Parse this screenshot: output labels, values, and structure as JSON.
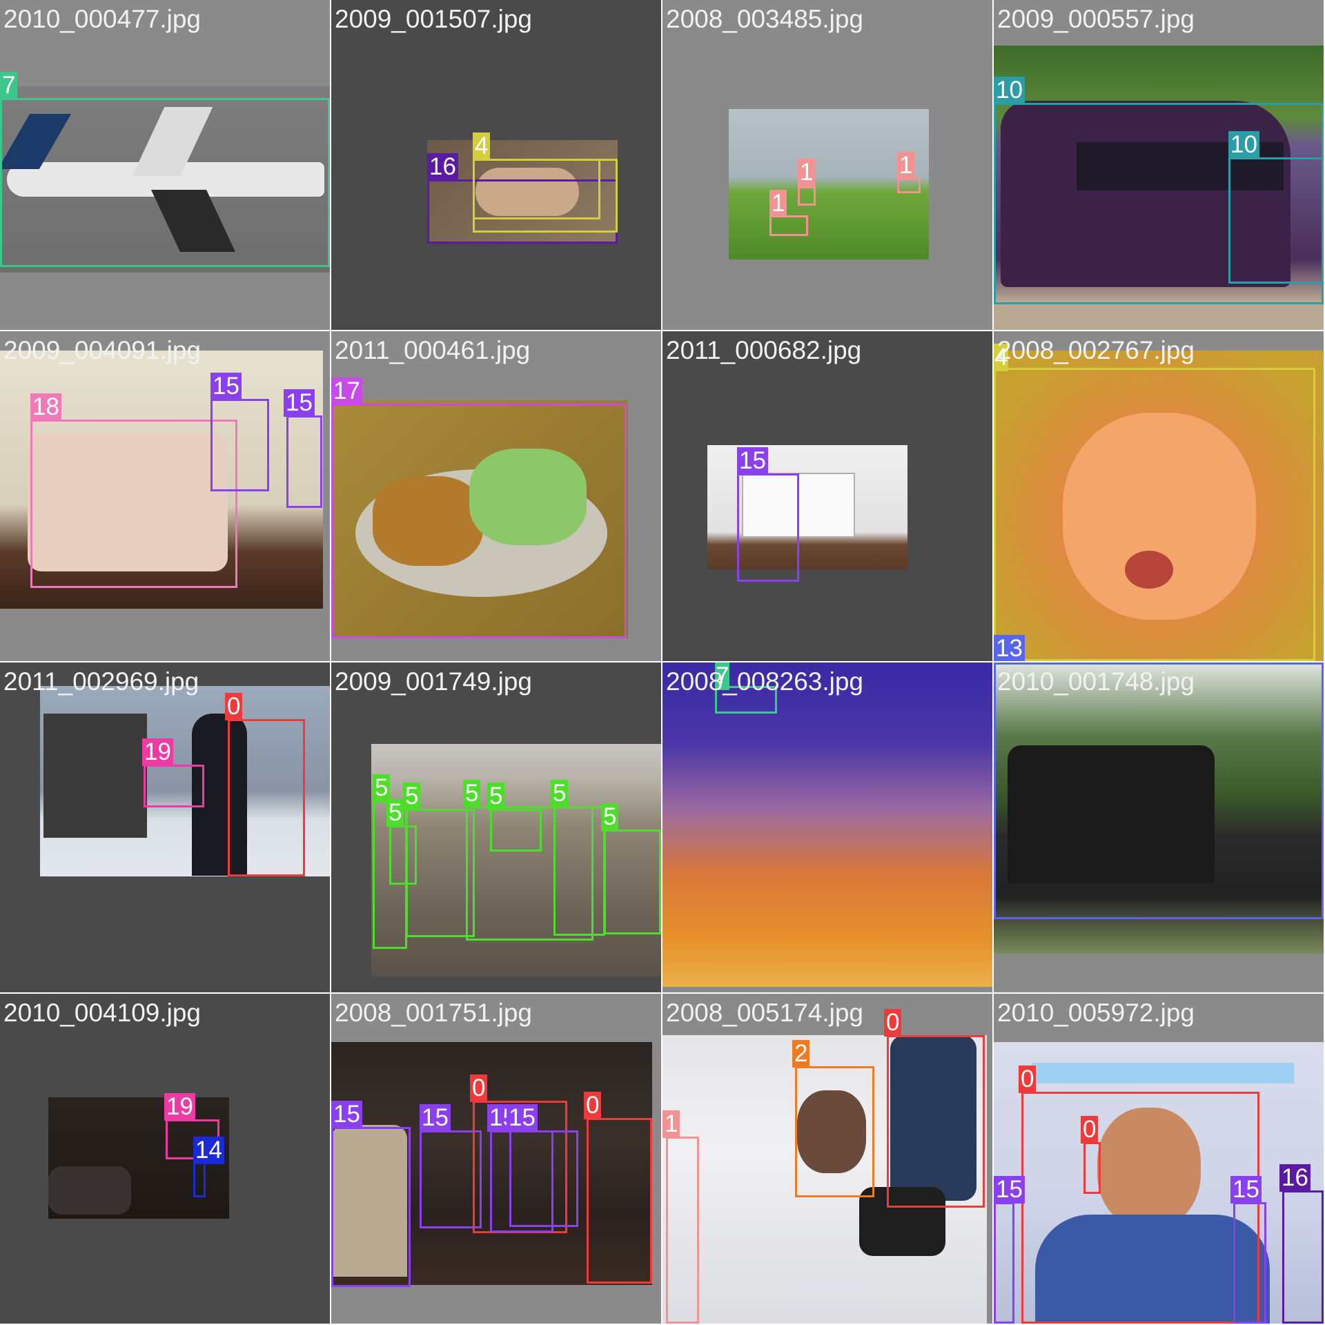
{
  "grid": {
    "columns": 4,
    "rows": 4,
    "tiles": [
      {
        "filename": "2010_000477.jpg",
        "labels": [
          "7"
        ]
      },
      {
        "filename": "2009_001507.jpg",
        "labels": [
          "16",
          "4"
        ]
      },
      {
        "filename": "2008_003485.jpg",
        "labels": [
          "1",
          "1",
          "1"
        ]
      },
      {
        "filename": "2009_000557.jpg",
        "labels": [
          "10",
          "10"
        ]
      },
      {
        "filename": "2009_004091.jpg",
        "labels": [
          "18",
          "15",
          "15"
        ]
      },
      {
        "filename": "2011_000461.jpg",
        "labels": [
          "17"
        ]
      },
      {
        "filename": "2011_000682.jpg",
        "labels": [
          "15"
        ]
      },
      {
        "filename": "2008_002767.jpg",
        "labels": [
          "4",
          "13"
        ]
      },
      {
        "filename": "2011_002969.jpg",
        "labels": [
          "0",
          "19"
        ]
      },
      {
        "filename": "2009_001749.jpg",
        "labels": [
          "5",
          "5",
          "5",
          "5",
          "5",
          "5",
          "5"
        ]
      },
      {
        "filename": "2008_008263.jpg",
        "labels": [
          "7"
        ]
      },
      {
        "filename": "2010_001748.jpg",
        "labels": []
      },
      {
        "filename": "2010_004109.jpg",
        "labels": [
          "19",
          "14"
        ]
      },
      {
        "filename": "2008_001751.jpg",
        "labels": [
          "15",
          "15",
          "0",
          "15",
          "15",
          "0"
        ]
      },
      {
        "filename": "2008_005174.jpg",
        "labels": [
          "0",
          "2",
          "1"
        ]
      },
      {
        "filename": "2010_005972.jpg",
        "labels": [
          "0",
          "0",
          "15",
          "15",
          "16"
        ]
      }
    ]
  },
  "class_colors": {
    "0": "#ee3a3a",
    "1": "#f39292",
    "2": "#f07a20",
    "4": "#d4ce3a",
    "5": "#4cde2a",
    "7": "#3cc88a",
    "10": "#2a9ea6",
    "13": "#5a66ea",
    "14": "#1a2ad8",
    "15": "#8a40ee",
    "16": "#5a1aa4",
    "17": "#c84ae8",
    "18": "#f07ab8",
    "19": "#ee3aa4"
  },
  "icons": {
    "photo-thumbnail": "image-placeholder-icon"
  }
}
